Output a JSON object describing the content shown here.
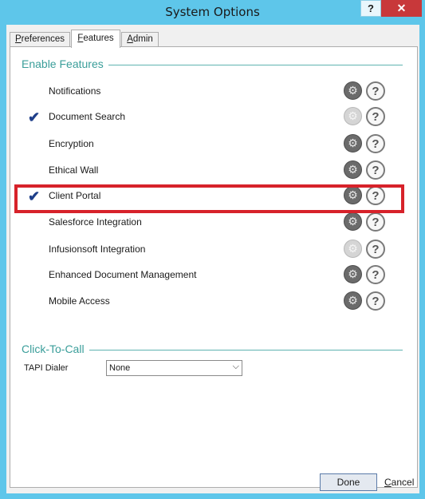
{
  "window": {
    "title": "System Options",
    "help_label": "?",
    "close_label": "✕"
  },
  "tabs": [
    {
      "label_pre": "",
      "label_u": "P",
      "label_post": "references"
    },
    {
      "label_pre": "",
      "label_u": "F",
      "label_post": "eatures"
    },
    {
      "label_pre": "",
      "label_u": "A",
      "label_post": "dmin"
    }
  ],
  "active_tab": "Features",
  "enable_features": {
    "title": "Enable Features",
    "items": [
      {
        "label": "Notifications",
        "checked": false,
        "settings_enabled": true
      },
      {
        "label": "Document Search",
        "checked": true,
        "settings_enabled": false
      },
      {
        "label": "Encryption",
        "checked": false,
        "settings_enabled": true
      },
      {
        "label": "Ethical Wall",
        "checked": false,
        "settings_enabled": true
      },
      {
        "label": "Client Portal",
        "checked": true,
        "settings_enabled": true
      },
      {
        "label": "Salesforce Integration",
        "checked": false,
        "settings_enabled": true
      },
      {
        "label": "Infusionsoft Integration",
        "checked": false,
        "settings_enabled": false
      },
      {
        "label": "Enhanced Document Management",
        "checked": false,
        "settings_enabled": true
      },
      {
        "label": "Mobile Access",
        "checked": false,
        "settings_enabled": true
      }
    ],
    "icons": {
      "settings": "gear-icon",
      "help": "question-icon",
      "check": "checkmark-icon"
    }
  },
  "click_to_call": {
    "title": "Click-To-Call",
    "tapi_label": "TAPI Dialer",
    "tapi_value": "None"
  },
  "footer": {
    "done_label": "Done",
    "cancel_u": "C",
    "cancel_rest": "ancel"
  },
  "colors": {
    "titlebar": "#5ec6ea",
    "close": "#c8383a",
    "group_title": "#3a9e9a",
    "highlight": "#d7222a",
    "check": "#1f3f8a"
  }
}
